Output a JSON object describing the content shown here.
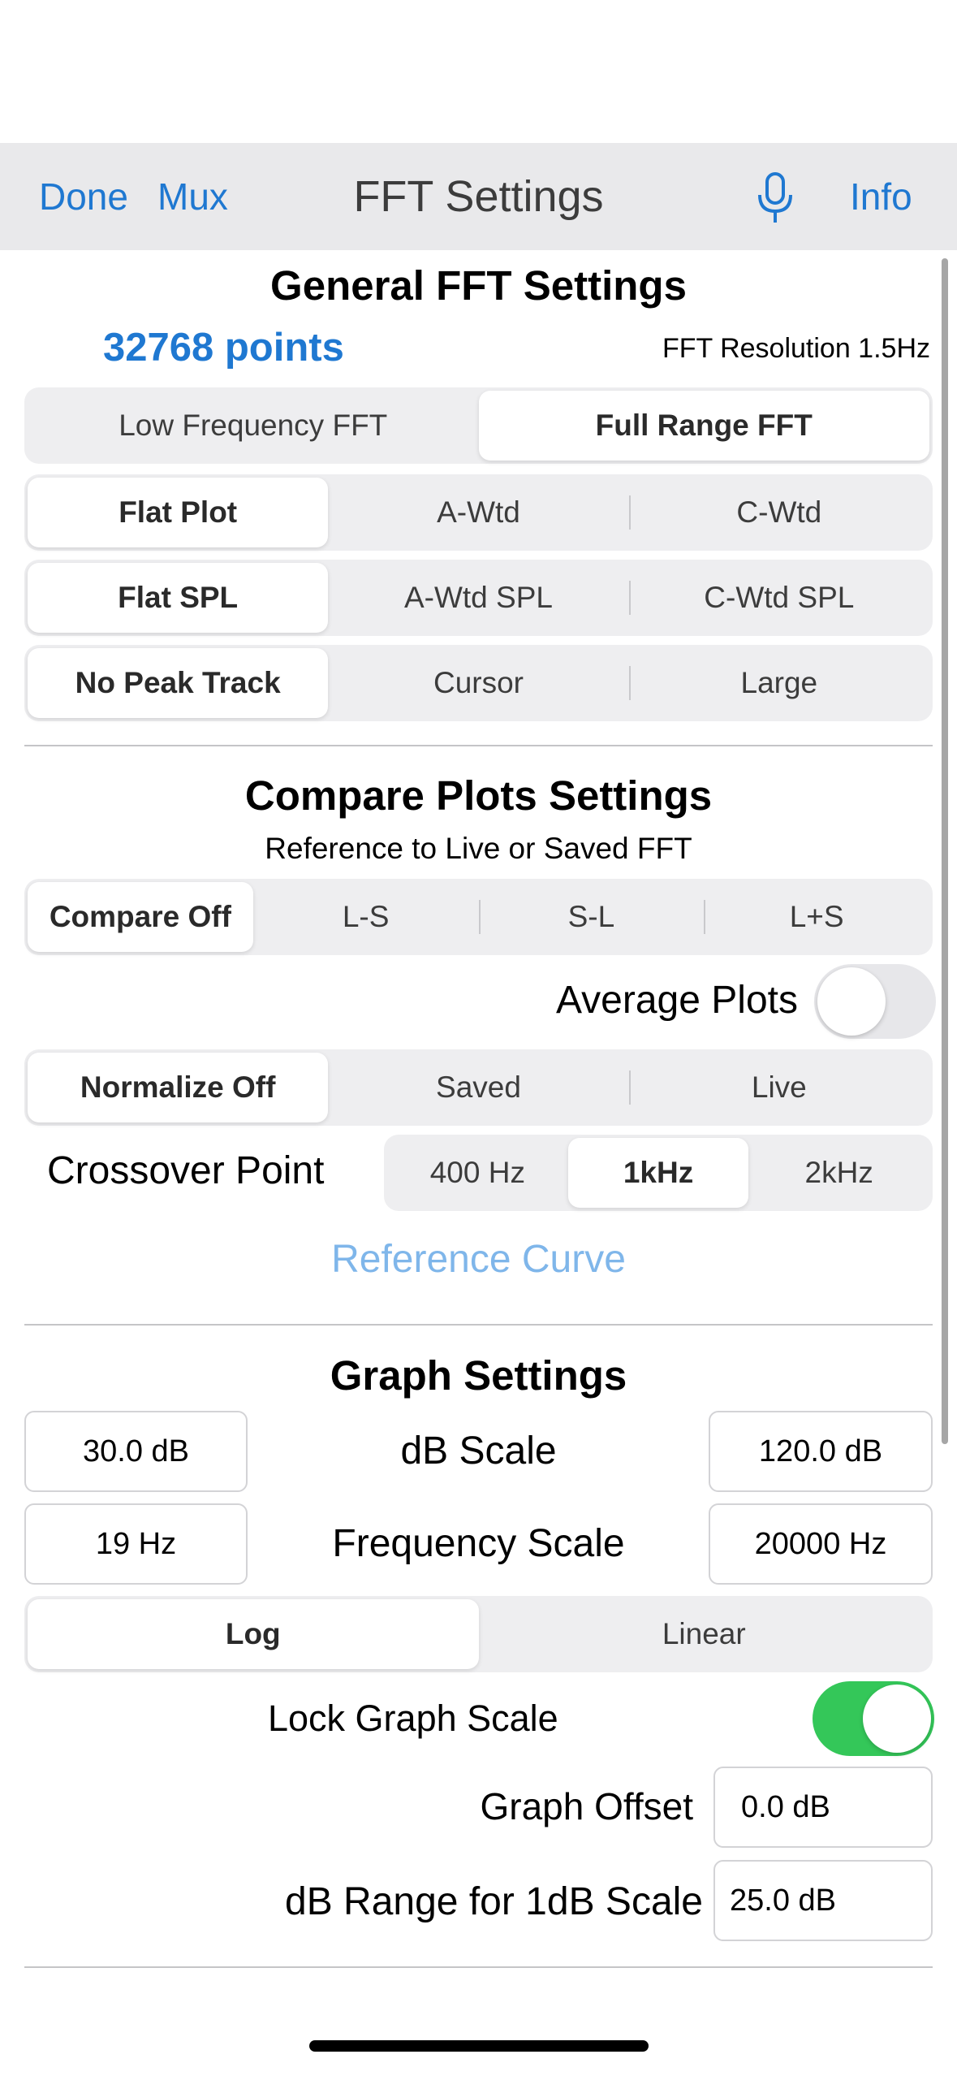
{
  "nav": {
    "done": "Done",
    "mux": "Mux",
    "title": "FFT Settings",
    "mic_icon": "microphone-icon",
    "info": "Info"
  },
  "general": {
    "title": "General FFT Settings",
    "points": "32768 points",
    "resolution": "FFT Resolution 1.5Hz",
    "range_segments": [
      "Low Frequency FFT",
      "Full Range FFT"
    ],
    "plot_segments": [
      "Flat Plot",
      "A-Wtd",
      "C-Wtd"
    ],
    "spl_segments": [
      "Flat SPL",
      "A-Wtd SPL",
      "C-Wtd SPL"
    ],
    "peak_segments": [
      "No Peak Track",
      "Cursor",
      "Large"
    ]
  },
  "compare": {
    "title": "Compare Plots Settings",
    "subtitle": "Reference to Live or Saved FFT",
    "compare_segments": [
      "Compare Off",
      "L-S",
      "S-L",
      "L+S"
    ],
    "average_label": "Average Plots",
    "average_on": false,
    "normalize_segments": [
      "Normalize Off",
      "Saved",
      "Live"
    ],
    "crossover_label": "Crossover Point",
    "crossover_segments": [
      "400 Hz",
      "1kHz",
      "2kHz"
    ],
    "reference_curve": "Reference Curve"
  },
  "graph": {
    "title": "Graph Settings",
    "db_min": "30.0 dB",
    "db_label": "dB Scale",
    "db_max": "120.0 dB",
    "freq_min": "19 Hz",
    "freq_label": "Frequency Scale",
    "freq_max": "20000 Hz",
    "scale_segments": [
      "Log",
      "Linear"
    ],
    "lock_label": "Lock Graph Scale",
    "lock_on": true,
    "offset_label": "Graph Offset",
    "offset_value": "0.0 dB",
    "range_label": "dB Range for 1dB Scale",
    "range_value": "25.0 dB"
  },
  "colors": {
    "accent": "#1f78d1",
    "toggle_on": "#34c759",
    "link_disabled": "#7fb6ea"
  }
}
